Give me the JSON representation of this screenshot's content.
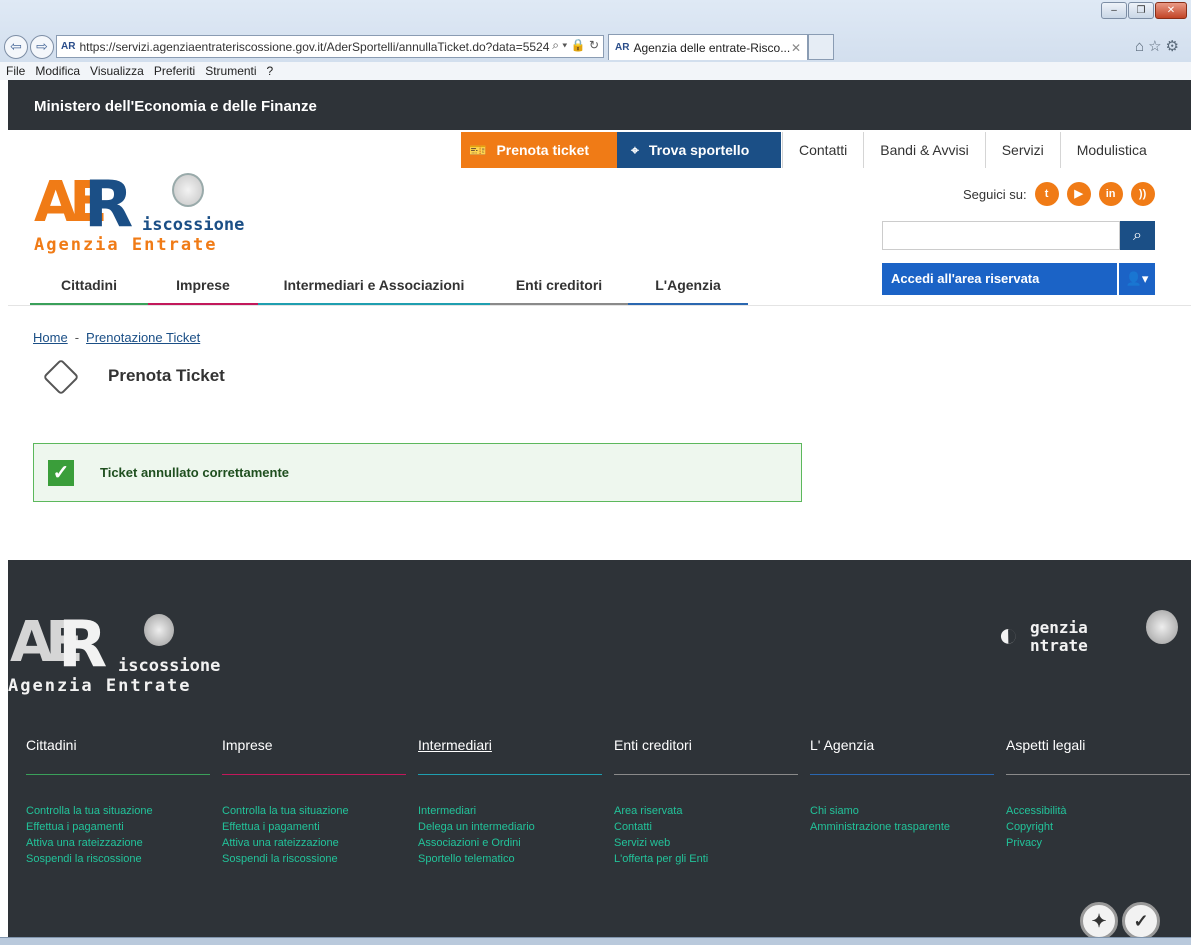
{
  "browser": {
    "url": "https://servizi.agenziaentrateriscossione.gov.it/AderSportelli/annullaTicket.do?data=5524",
    "favicon_text": "AR",
    "tab_title": "Agenzia delle entrate-Risco...",
    "menu": [
      "File",
      "Modifica",
      "Visualizza",
      "Preferiti",
      "Strumenti",
      "?"
    ]
  },
  "site": {
    "ministry": "Ministero dell'Economia e delle Finanze",
    "prenota_ticket": "Prenota ticket",
    "trova_sportello": "Trova sportello",
    "top_nav": [
      "Contatti",
      "Bandi & Avvisi",
      "Servizi",
      "Modulistica"
    ],
    "logo": {
      "ae": "AE",
      "r": "R",
      "iscossione": "iscossione",
      "agenzia_entrate": "Agenzia Entrate"
    },
    "seguici": "Seguici su:",
    "social": [
      "twitter",
      "youtube",
      "linkedin",
      "rss"
    ],
    "search_placeholder": "",
    "area_riservata": "Accedi all'area riservata",
    "main_nav": [
      "Cittadini",
      "Imprese",
      "Intermediari e Associazioni",
      "Enti creditori",
      "L'Agenzia"
    ]
  },
  "content": {
    "breadcrumb": [
      "Home",
      "Prenotazione Ticket"
    ],
    "breadcrumb_sep": "-",
    "page_title": "Prenota Ticket",
    "success_message": "Ticket annullato correttamente"
  },
  "footer": {
    "ae_logo": {
      "genzia": "genzia",
      "ntrate": "ntrate"
    },
    "columns": [
      {
        "title": "Cittadini",
        "links": [
          "Controlla la tua situazione",
          "Effettua i pagamenti",
          "Attiva una rateizzazione",
          "Sospendi la riscossione"
        ]
      },
      {
        "title": "Imprese",
        "links": [
          "Controlla la tua situazione",
          "Effettua i pagamenti",
          "Attiva una rateizzazione",
          "Sospendi la riscossione"
        ]
      },
      {
        "title": "Intermediari",
        "links": [
          "Intermediari",
          "Delega un intermediario",
          "Associazioni e Ordini",
          "Sportello telematico"
        ]
      },
      {
        "title": "Enti creditori",
        "links": [
          "Area riservata",
          "Contatti",
          "Servizi web",
          "L'offerta per gli Enti"
        ]
      },
      {
        "title": "L' Agenzia",
        "links": [
          "Chi siamo",
          "Amministrazione trasparente"
        ]
      },
      {
        "title": "Aspetti legali",
        "links": [
          "Accessibilità",
          "Copyright",
          "Privacy"
        ]
      }
    ]
  },
  "colors": {
    "orange": "#f07b16",
    "navy": "#1b4f86",
    "blue": "#1b63c6",
    "dark": "#2e3338",
    "footer_link": "#22c39a",
    "success_border": "#5cb85c"
  }
}
